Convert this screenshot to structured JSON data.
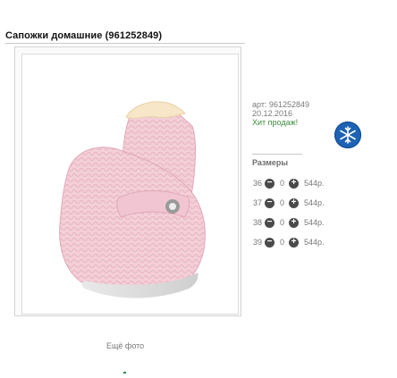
{
  "product": {
    "title": "Сапожки домашние (961252849)",
    "more_photos_label": "Ещё фото"
  },
  "info": {
    "article_label": "арт: 961252849",
    "date": "20.12.2016",
    "hit_label": "Хит продаж!",
    "sizes_label": "Размеры"
  },
  "sizes": [
    {
      "size": "36",
      "qty": "0",
      "price": "544р."
    },
    {
      "size": "37",
      "qty": "0",
      "price": "544р."
    },
    {
      "size": "38",
      "qty": "0",
      "price": "544р."
    },
    {
      "size": "39",
      "qty": "0",
      "price": "544р."
    }
  ],
  "icons": {
    "minus": "minus-icon",
    "plus": "plus-icon",
    "season": "snowflake-icon"
  },
  "colors": {
    "hit_green": "#3e8d3e",
    "season_badge_blue": "#1e62b4",
    "button_gray": "#4a4a4a"
  }
}
